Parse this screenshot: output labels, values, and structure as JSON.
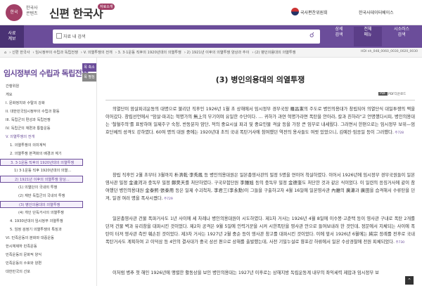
{
  "header": {
    "logo_text": "한국",
    "org_name": "한국사\n콘텐츠",
    "brand": "신편 한국사",
    "badge": "자료소개",
    "inst1": "국사편찬위원회",
    "inst2": "한국사데이터베이스"
  },
  "bar": {
    "menu_label": "사료\n계보",
    "checkbox_label": "자료 내 검색",
    "nav": [
      "상세\n검색",
      "전체\n메뉴",
      "시소러스\n검색"
    ]
  },
  "breadcrumbs": [
    "⌂",
    "신편 한국사",
    "임시정부의 수립과 독립전쟁",
    "V. 의열투쟁의 전개",
    "3. 3·1운동 직후의 1920년대의 의열투쟁",
    "2) 1921년 이후의 의열투쟁 양상과 추이",
    "(2) 병인의용대의 의열투쟁"
  ],
  "doc_id": "HDI nh_048_0060_0030_0020_0030",
  "sidebar": {
    "title": "임시정부의 수립과 독립전쟁",
    "buttons": [
      "목 축소",
      "목 펼침"
    ],
    "items": [
      {
        "text": "간행위원",
        "indent": 8
      },
      {
        "text": "게요",
        "indent": 8
      },
      {
        "text": "I. 문화정치와 수탈의 강화",
        "indent": 8
      },
      {
        "text": "II. 대한민국임시정부의 수립과 활동",
        "indent": 8
      },
      {
        "text": "III. 독립군의 편성과 독립전쟁",
        "indent": 8
      },
      {
        "text": "IV. 독립군의 재편과 통합운동",
        "indent": 8
      },
      {
        "text": "V. 의열투쟁의 전개",
        "indent": 8,
        "sel": true
      },
      {
        "text": "1. 의열투쟁의 의미계적",
        "indent": 14
      },
      {
        "text": "2. 의열투쟁 본격화의 배경과 계기",
        "indent": 14
      },
      {
        "text": "3. 3·1운동 직후의 1920년대의 의열투쟁",
        "indent": 14,
        "sel": true,
        "box": true
      },
      {
        "text": "1) 3·1운동 직후 1920년대의 의열...",
        "indent": 20
      },
      {
        "text": "2) 1921년 이후의 의열투쟁 양상...",
        "indent": 20,
        "sel": true,
        "box": true
      },
      {
        "text": "(1) 의열단의 국내외 투쟁",
        "indent": 26
      },
      {
        "text": "(2) 재만 독립군의 국내외 투쟁",
        "indent": 26
      },
      {
        "text": "(3) 병인의용대의 의열투쟁",
        "indent": 26,
        "sel": true,
        "box": true
      },
      {
        "text": "(4) 개인 단독거사의 의열투쟁",
        "indent": 26
      },
      {
        "text": "4. 1930년대의 임시정부 의열투쟁",
        "indent": 14
      },
      {
        "text": "5. 임정 검정기 의열투쟁의 특징과",
        "indent": 14
      },
      {
        "text": "VI. 민족운동의 분화와 대중운동",
        "indent": 8
      },
      {
        "text": "한시체제하 민족운동",
        "indent": 8
      },
      {
        "text": "민족운동의 문화적 양식",
        "indent": 8
      },
      {
        "text": "민족운동의 수호와 양편",
        "indent": 8
      },
      {
        "text": "대한민국의 선포",
        "indent": 8
      }
    ]
  },
  "main": {
    "pdf_icon": "PDF",
    "pdf_label": "PDF다운로드",
    "heading": "(3) 병인의용대의 의열투쟁",
    "paragraphs": [
      {
        "text": "의열단이 암살파괴운동의 대명으로 불리던 직후인 1926년 1월 초 상해에서 임시정부 경무국장 羅昌憲의 주도로 병인의용대가 창립되어 의열단식 대일투쟁의 맥을 이어갔다. 창립선언에서 \"암살·파괴는 혁명가의 無上의 무기이며 유일한 수단이다. … 귀하가 과연 혁명가라면 폭탄을 안아라, 칼과 친하라\"고 언명했다시피, 병인의용대는 '철혈주의'를 표방하며 일제주구 숙청, 반동분자 암단, 적의 중요시설 파괴 및 중요인물 격살 등을 가장 큰 임무로 내세웠다. 그러면서 한편으로는 임시정부 보위—엄호단체의 성격도 강하였다. 60여 명의 대원 중에는 1920년대 초의 국내 폭탄거사에 참여했던 역전의 용사들도 여럿 있었으니, 김예진·임응일 등이 그러했다.",
        "fn": "주728"
      },
      {
        "text": "창립 직후인 2월 초부터 3월까지 朴濟乾·李秀鳳 등 병인의용대원은 일본총영사관의 밀정 5명을 연이어 척살하였다. 이어서 1926년에 임시정부 경무국원들이 일본영사관 밀정 金達河과 충독부 밀정 鄭昊天를 처단하였다. 구국모험단원 李鍾旭 등의 충독부 밀정 金德奎도 처단한 것과 같은 식이었다. 이 일련의 응징거사에 같이 참여했던 병인의용대원 金泰熙·張泰用 등은 일제 수괴척처, 李君三(李永勳)이 그들을 구출하고자 4월 16일에 일본영사관 內廳의 廣瀨과 廣田을 습격해서 수류탄을 던져, 일경 여러 명을 폭사시켰다.",
        "fn": "주729"
      },
      {
        "text": "일본총영사관 건물 폭파거사도 1년 사이에 세 차례나 병인의용대원이 시도하였다. 제1차 거사는 1926년 4월 8일에 이수봉·고준택 등이 영사관 구내로 폭탄 2개를 던져 건물 벽과 유리창을 대파시킨 것이었다. 제2차 공격은 9월 5일에 인력거꾼을 시켜 시한폭탄을 영사관 안으로 들여보내려 한 것인데, 정문에서 지체되는 사이에 폭탄이 터져 영사관 측만 훼손된 것이었다. 제3차 거사는 1927년 2월 중순 등이 영사관 창고를 대파시킨 것이었다. 이에 앞서 1926년 6월에는 純宗 장례를 전후로 국내 폭탄거사도 계획하여 고 이덕삼 등 4인의 결사대가 중국 상선 편으로 상해를 출발했는데, 사전 기밀누설로 향포강 하류에서 일본 수상경찰에 전원 피체되었다.",
        "fn": "주730"
      },
      {
        "text": "이처럼 병추 첫 해인 1926년에 맹렬한 활동상을 보인 병인의용대는 1927년 이후로는 상해지방 독립운동계 내부의 좌익세력 제압과 임시정부 보"
      }
    ]
  }
}
